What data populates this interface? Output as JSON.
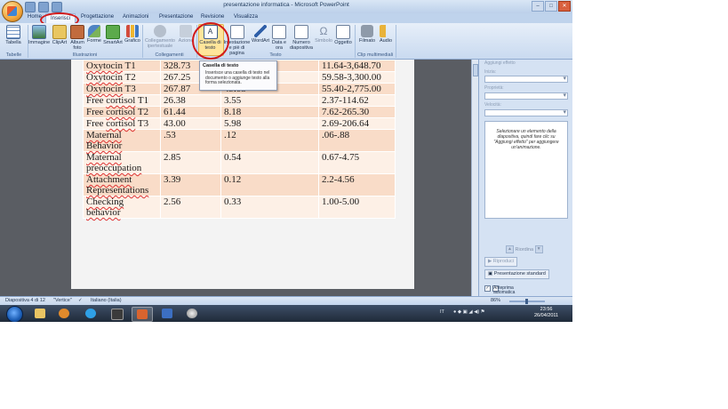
{
  "window": {
    "title": "presentazione informatica - Microsoft PowerPoint",
    "controls": [
      "–",
      "□",
      "✕"
    ]
  },
  "tabs": [
    {
      "label": "Home"
    },
    {
      "label": "Inserisci",
      "active": true
    },
    {
      "label": "Progettazione"
    },
    {
      "label": "Animazioni"
    },
    {
      "label": "Presentazione"
    },
    {
      "label": "Revisione"
    },
    {
      "label": "Visualizza"
    }
  ],
  "ribbon": {
    "groups": [
      {
        "label": "Tabelle",
        "buttons": [
          {
            "label": "Tabella",
            "icon": "table-icon"
          }
        ]
      },
      {
        "label": "Illustrazioni",
        "buttons": [
          {
            "label": "Immagine",
            "icon": "picture-icon"
          },
          {
            "label": "ClipArt",
            "icon": "clipart-icon"
          },
          {
            "label": "Album foto",
            "icon": "photo-album-icon"
          },
          {
            "label": "Forme",
            "icon": "shapes-icon"
          },
          {
            "label": "SmartArt",
            "icon": "smartart-icon"
          },
          {
            "label": "Grafico",
            "icon": "chart-icon"
          }
        ]
      },
      {
        "label": "Collegamenti",
        "buttons": [
          {
            "label": "Collegamento ipertestuale",
            "icon": "hyperlink-icon",
            "disabled": true
          },
          {
            "label": "Azione",
            "icon": "action-icon",
            "disabled": true
          }
        ]
      },
      {
        "label": "Testo",
        "buttons": [
          {
            "label": "Casella di testo",
            "icon": "textbox-icon",
            "highlighted": true
          },
          {
            "label": "Intestazione e piè di pagina",
            "icon": "header-footer-icon"
          },
          {
            "label": "WordArt",
            "icon": "wordart-icon"
          },
          {
            "label": "Data e ora",
            "icon": "date-time-icon"
          },
          {
            "label": "Numero diapositiva",
            "icon": "slide-number-icon"
          },
          {
            "label": "Simbolo",
            "icon": "symbol-icon",
            "disabled": true
          },
          {
            "label": "Oggetto",
            "icon": "object-icon"
          }
        ]
      },
      {
        "label": "Clip multimediali",
        "buttons": [
          {
            "label": "Filmato",
            "icon": "movie-icon"
          },
          {
            "label": "Audio",
            "icon": "audio-icon"
          }
        ]
      }
    ]
  },
  "tooltip": {
    "title": "Casella di testo",
    "body": "Inserisce una casella di testo nel documento o aggiunge testo alla forma selezionata."
  },
  "table": {
    "rows": [
      {
        "label": "Oxytocin T1",
        "mean": "328.73",
        "sd": "",
        "range": "11.64-3,648.70"
      },
      {
        "label": "Oxytocin T2",
        "mean": "267.25",
        "sd": "",
        "range": "59.58-3,300.00"
      },
      {
        "label": "Oxytocin T3",
        "mean": "267.87",
        "sd": "49.05",
        "range": "55.40-2,775.00"
      },
      {
        "label": "Free cortisol T1",
        "mean": "26.38",
        "sd": "3.55",
        "range": "2.37-114.62"
      },
      {
        "label": "Free cortisol T2",
        "mean": "61.44",
        "sd": "8.18",
        "range": "7.62-265.30"
      },
      {
        "label": "Free cortisol T3",
        "mean": "43.00",
        "sd": "5.98",
        "range": "2.69-206.64"
      },
      {
        "label": "Maternal Behavior",
        "mean": ".53",
        "sd": ".12",
        "range": ".06-.88"
      },
      {
        "label": "Maternal preoccupation",
        "mean": "2.85",
        "sd": "0.54",
        "range": "0.67-4.75"
      },
      {
        "label": "Attachment Representations",
        "mean": "3.39",
        "sd": "0.12",
        "range": "2.2-4.56"
      },
      {
        "label": "Checking behavior",
        "mean": "2.56",
        "sd": "0.33",
        "range": "1.00-5.00"
      }
    ]
  },
  "pane": {
    "header": "Aggiungi effetto",
    "fields": [
      "Inizia:",
      "Proprietà:",
      "Velocità:"
    ],
    "message": "Selezionare un elemento della diapositiva, quindi fare clic su \"Aggiungi effetto\" per aggiungere un'animazione.",
    "reorder": "Riordina",
    "play": "Riproduci",
    "slideshow": "Presentazione standard",
    "autopreview": "Anteprima automatica"
  },
  "status": {
    "slide": "Diapositiva 4 di 12",
    "theme": "\"Vertice\"",
    "language": "Italiano (Italia)",
    "zoom": "86%"
  },
  "taskbar": {
    "lang": "IT",
    "time": "23:56",
    "date": "26/04/2011"
  },
  "colors": {
    "row_light": "#fdf0e6",
    "row_dark": "#f9dcc8",
    "highlight_circle": "#d21a1a",
    "ribbon_bg": "#dce8f6"
  }
}
